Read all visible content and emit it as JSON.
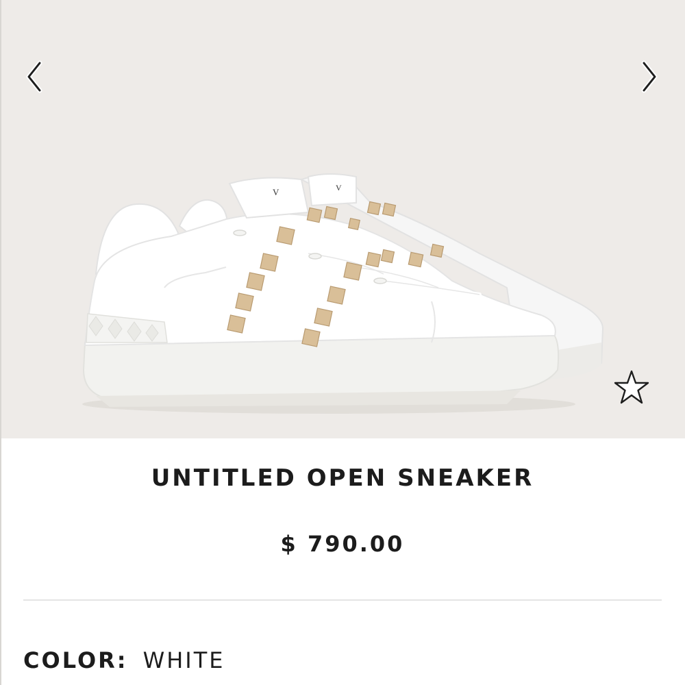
{
  "gallery": {
    "prev_icon": "chevron-left-icon",
    "next_icon": "chevron-right-icon",
    "favorite_icon": "star-outline-icon",
    "background_color": "#eeebe8",
    "stud_color": "#d9bf98"
  },
  "product": {
    "title": "UNTITLED OPEN SNEAKER",
    "price": "$ 790.00",
    "color_label": "COLOR:",
    "color_value": "WHITE"
  }
}
